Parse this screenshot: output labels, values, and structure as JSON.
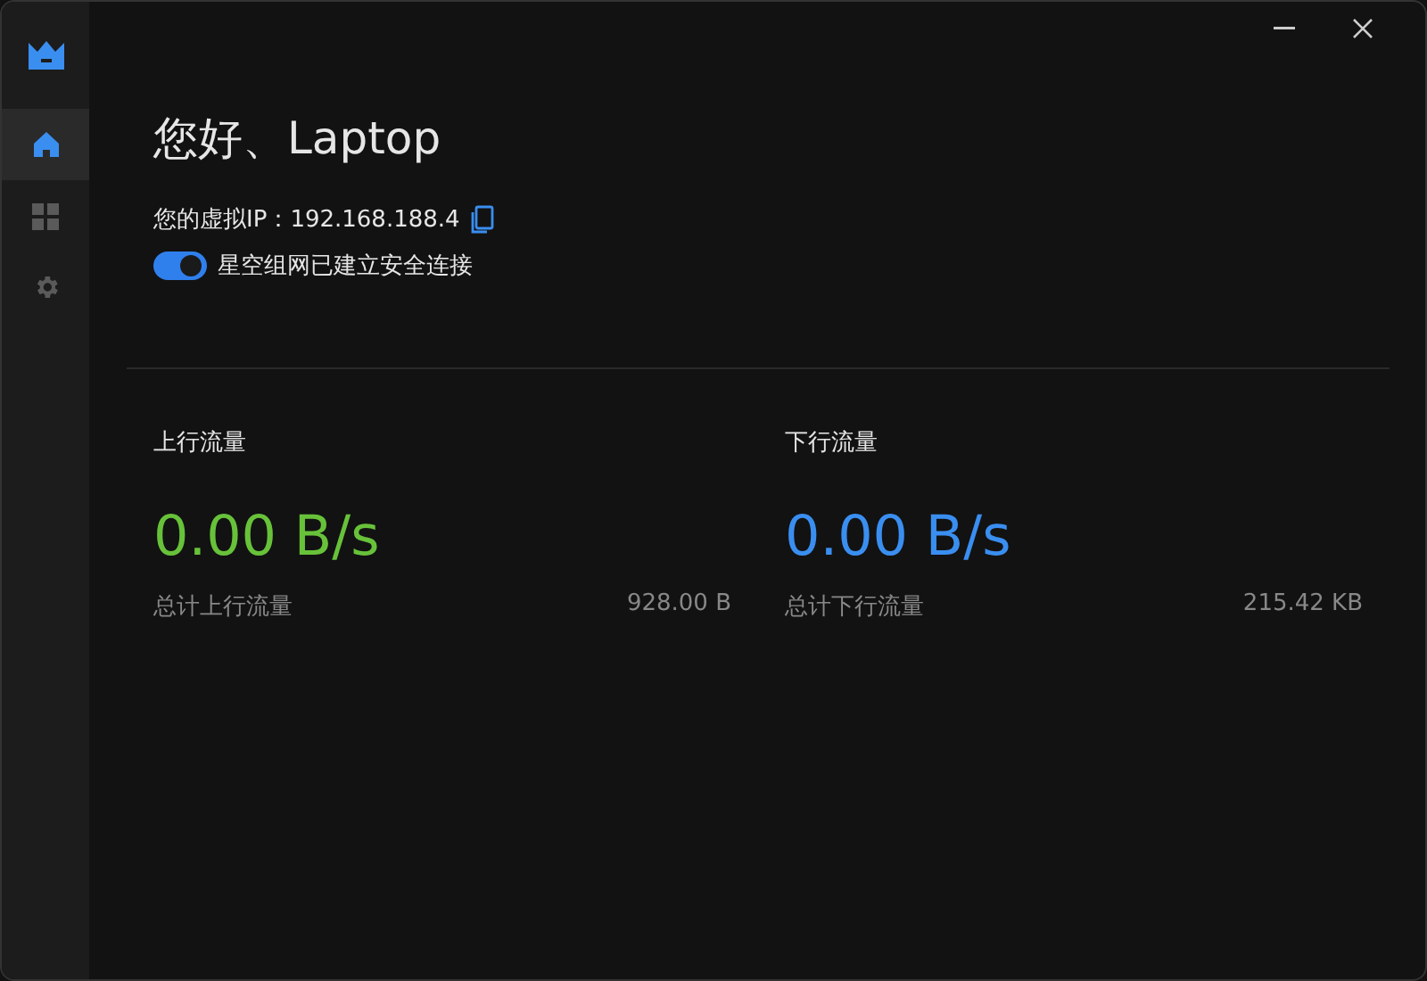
{
  "sidebar": {
    "items": [
      {
        "kind": "home",
        "selected": true
      },
      {
        "kind": "apps",
        "selected": false
      },
      {
        "kind": "settings",
        "selected": false
      }
    ]
  },
  "greeting": "您好、Laptop",
  "ip": {
    "label": "您的虚拟IP：",
    "value": "192.168.188.4"
  },
  "connection": {
    "on": true,
    "label": "星空组网已建立安全连接"
  },
  "stats": [
    {
      "title": "上行流量",
      "rate": "0.00 B/s",
      "color": "#67c23a",
      "total_label": "总计上行流量",
      "total": "928.00 B"
    },
    {
      "title": "下行流量",
      "rate": "0.00 B/s",
      "color": "#3a8ef0",
      "total_label": "总计下行流量",
      "total": "215.42 KB"
    }
  ]
}
